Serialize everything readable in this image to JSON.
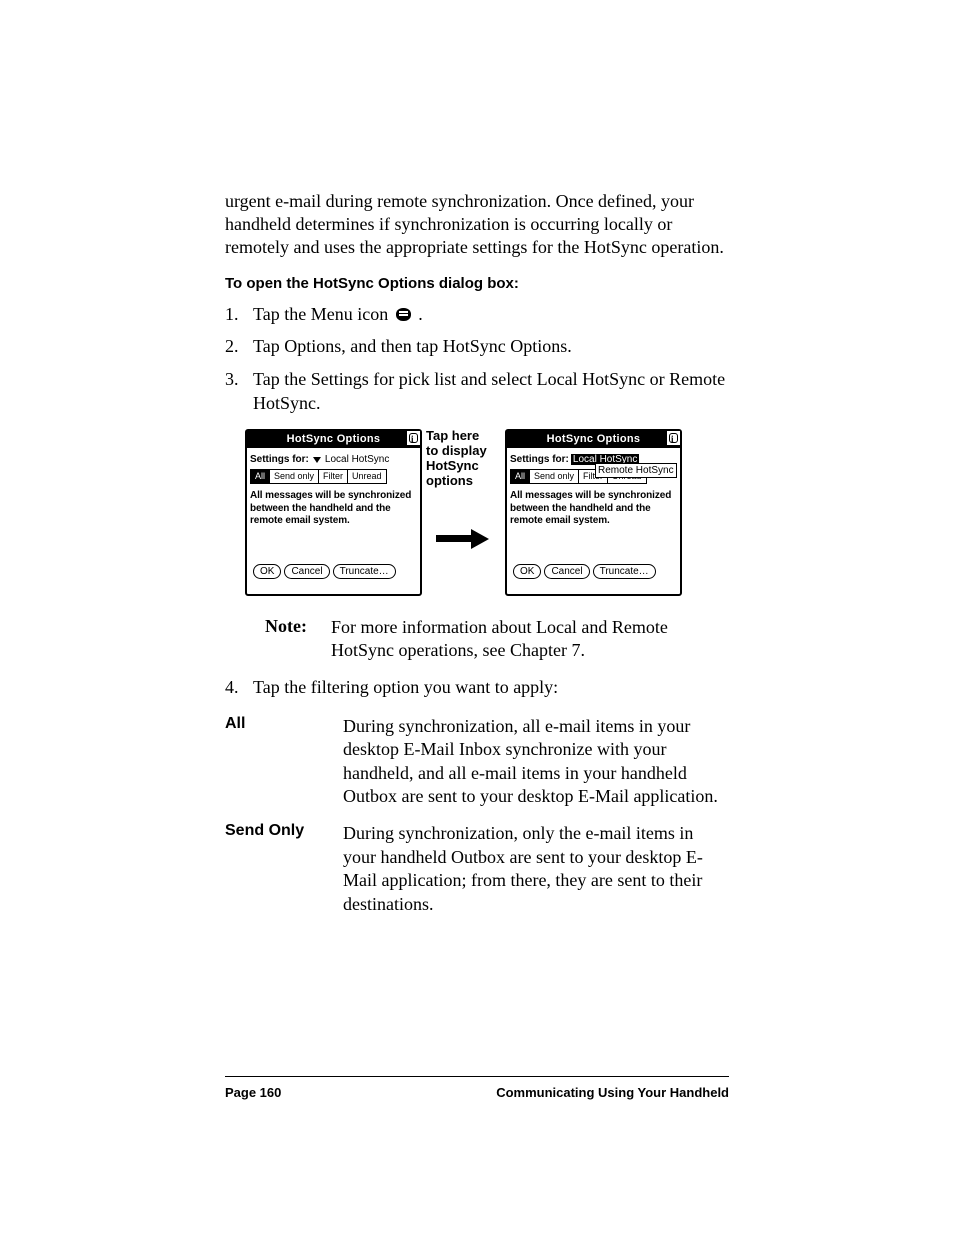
{
  "intro_paragraph": "urgent e-mail during remote synchronization. Once defined, your handheld determines if synchronization is occurring locally or remotely and uses the appropriate settings for the HotSync operation.",
  "subheading": "To open the HotSync Options dialog box:",
  "steps": {
    "s1_pre": "Tap the Menu icon ",
    "s1_post": ".",
    "s2": "Tap Options, and then tap HotSync Options.",
    "s3": "Tap the Settings for pick list and select Local HotSync or Remote HotSync.",
    "s4": "Tap the filtering option you want to apply:"
  },
  "screen_left": {
    "title": "HotSync Options",
    "settings_for_label": "Settings for:",
    "settings_for_value": "Local HotSync",
    "tabs": [
      "All",
      "Send only",
      "Filter",
      "Unread"
    ],
    "body_msg": "All messages will be synchronized between the handheld and the remote email system.",
    "buttons": [
      "OK",
      "Cancel",
      "Truncate…"
    ]
  },
  "screen_right": {
    "title": "HotSync Options",
    "settings_for_label": "Settings for:",
    "highlighted_value": "Local HotSync",
    "dropdown_item": "Remote HotSync",
    "tabs": [
      "All",
      "Send only",
      "Filter",
      "Unread"
    ],
    "body_msg": "All messages will be synchronized between the handheld and the remote email system.",
    "buttons": [
      "OK",
      "Cancel",
      "Truncate…"
    ]
  },
  "callout": {
    "l1": "Tap here",
    "l2": "to display",
    "l3": "HotSync",
    "l4": "options"
  },
  "note": {
    "label": "Note:",
    "text": "For more information about Local and Remote HotSync operations, see Chapter 7."
  },
  "definitions": {
    "all_term": "All",
    "all_desc": "During synchronization, all e-mail items in your desktop E-Mail Inbox synchronize with your handheld, and all e-mail items in your handheld Outbox are sent to your desktop E-Mail application.",
    "send_term": "Send Only",
    "send_desc": "During synchronization, only the e-mail items in your handheld Outbox are sent to your desktop E-Mail application; from there, they are sent to their destinations."
  },
  "footer": {
    "left": "Page 160",
    "right": "Communicating Using Your Handheld"
  }
}
